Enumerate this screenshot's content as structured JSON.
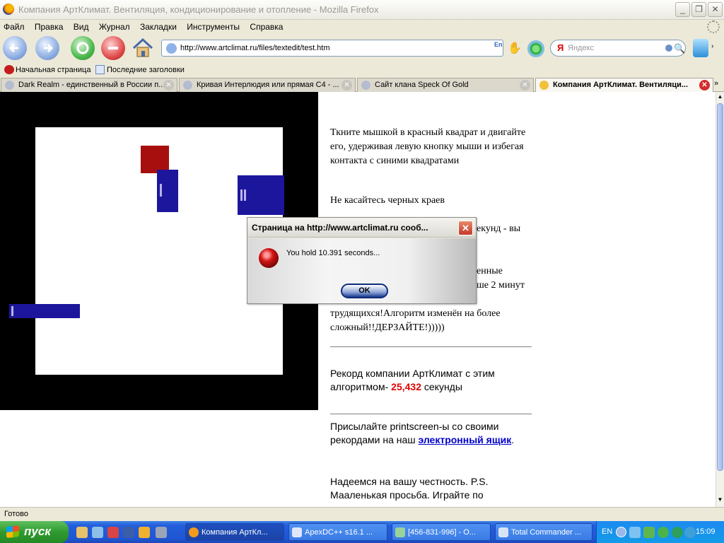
{
  "window": {
    "title": "Компания АртКлимат. Вентиляция, кондиционирование и отопление - Mozilla Firefox",
    "minimize_glyph": "_",
    "maximize_glyph": "❐",
    "close_glyph": "✕"
  },
  "menu": [
    "Файл",
    "Правка",
    "Вид",
    "Журнал",
    "Закладки",
    "Инструменты",
    "Справка"
  ],
  "nav": {
    "url": "http://www.artclimat.ru/files/textedit/test.htm",
    "search_placeholder": "Яндекс",
    "search_logo": "Я",
    "lang_badge": "En"
  },
  "bookmarks": [
    "Начальная страница",
    "Последние заголовки"
  ],
  "tabs": [
    {
      "label": "Dark Realm - единственный в России п...",
      "active": false
    },
    {
      "label": "Кривая Интерлюдия или прямая С4 - ...",
      "active": false
    },
    {
      "label": "Сайт клана Speck Of Gold",
      "active": false
    },
    {
      "label": "Компания АртКлимат. Вентиляци...",
      "active": true
    }
  ],
  "page": {
    "p1": "Ткните мышкой в красный квадрат и двигайте его, удерживая левую кнопку мыши и избегая контакта с синими квадратами",
    "p2": "Не касайтесь черных краев",
    "p3_tail_a": "екунд - вы",
    "p4_tail_a": "енные",
    "p4_tail_b": "ше 2 минут",
    "p4_line_c": "трудящихся!Алгоритм изменён на более",
    "p4_line_d": "сложный!!ДЕРЗАЙТЕ!)))))",
    "record_prefix": "Рекорд компании АртКлимат с этим алгоритмом-",
    "record_value": "25,432",
    "record_suffix": " секунды",
    "send_prefix": "Присылайте printscreen-ы со своими рекордами на наш ",
    "send_link": "электронный ящик",
    "send_suffix": ".",
    "honesty": "Надеемся на вашу честность. P.S. Мааленькая просьба. Играйте по"
  },
  "dialog": {
    "title": "Страница на http://www.artclimat.ru сооб...",
    "message": "You hold 10.391 seconds...",
    "ok": "OK",
    "close_glyph": "✕"
  },
  "status": "Готово",
  "taskbar": {
    "start": "пуск",
    "tasks": [
      {
        "label": "Компания АртКл...",
        "active": true
      },
      {
        "label": "ApexDC++ s16.1 ...",
        "active": false
      },
      {
        "label": "[456-831-996] - О...",
        "active": false
      },
      {
        "label": "Total Commander ...",
        "active": false
      }
    ],
    "lang": "EN",
    "clock": "15:09"
  },
  "colors": {
    "red_square": "#a70f0f",
    "blue_block": "#1c169c",
    "record": "#e00000",
    "link": "#0000cc"
  }
}
